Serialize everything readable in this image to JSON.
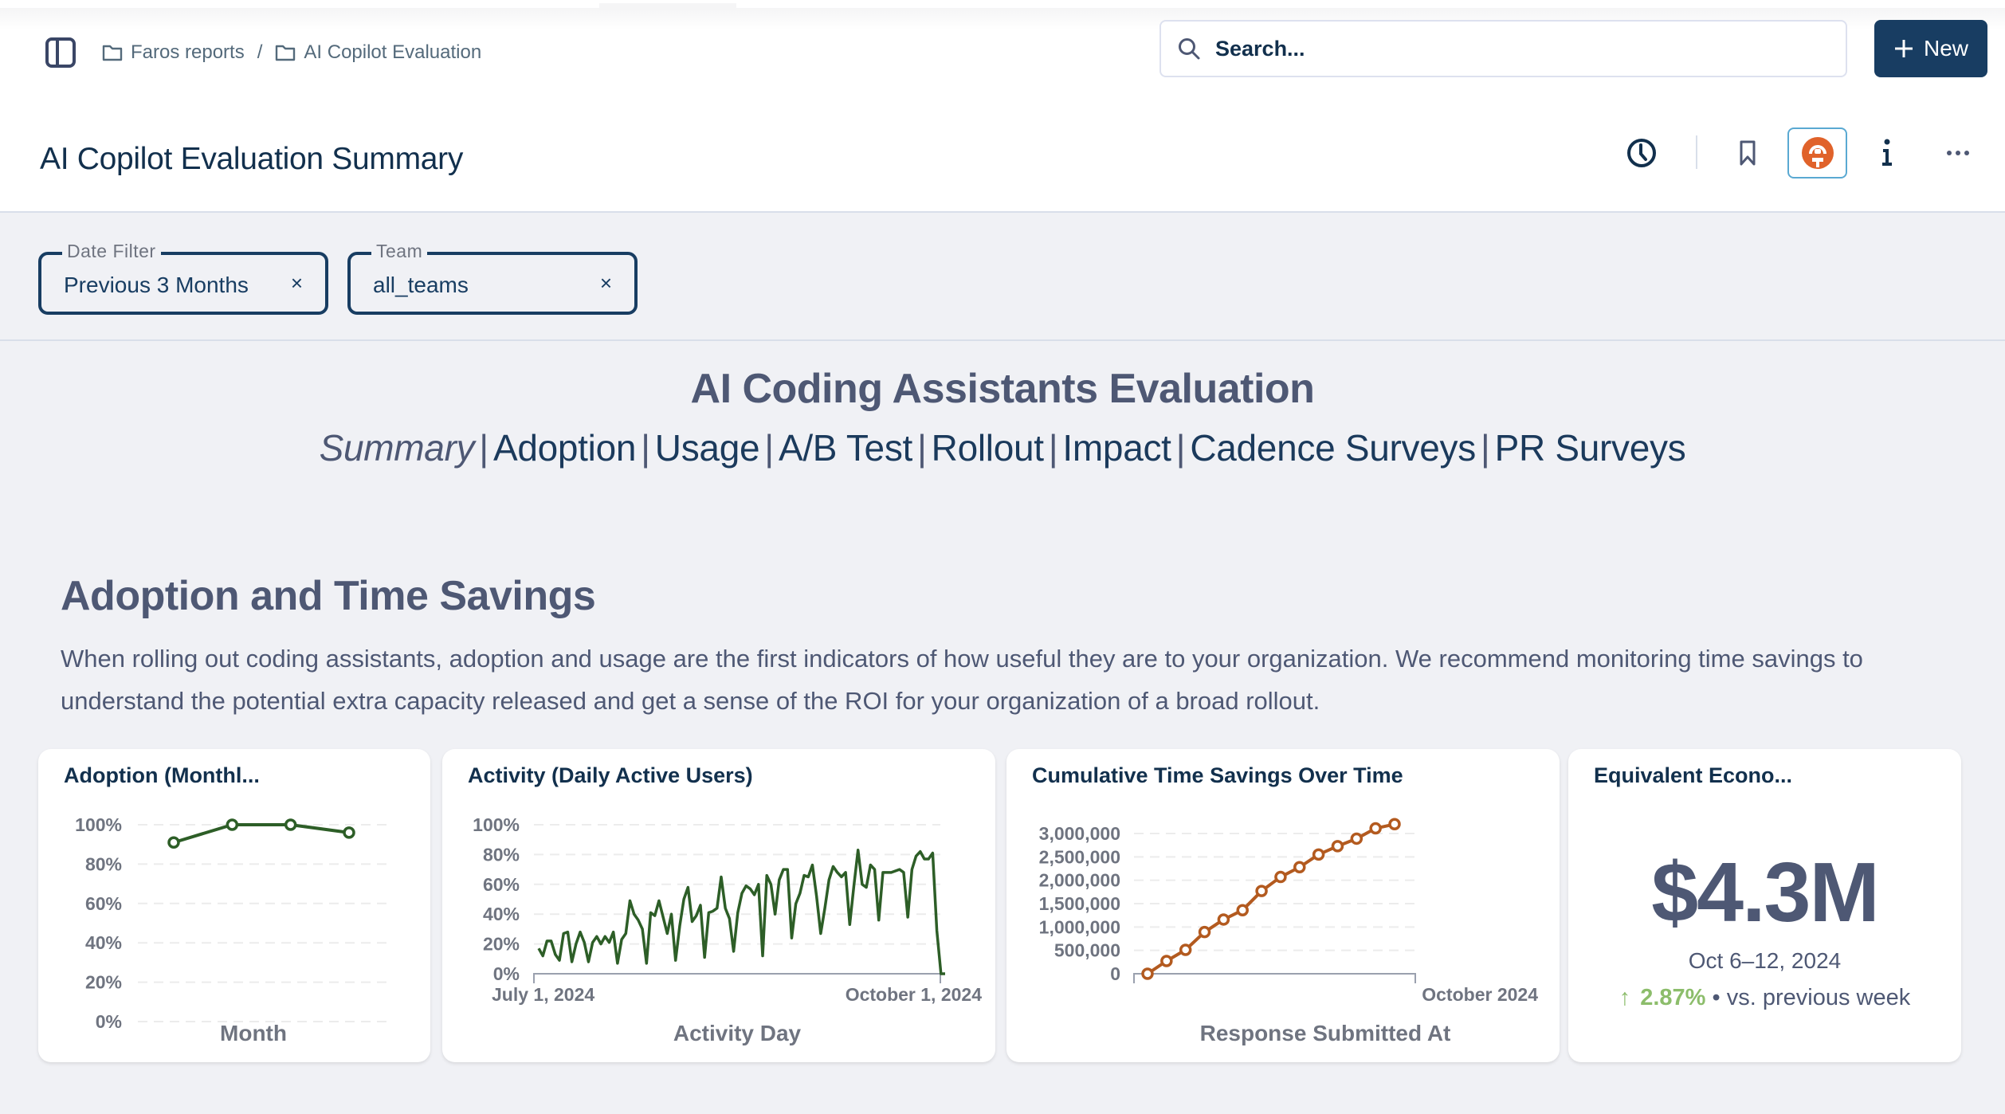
{
  "breadcrumb": [
    {
      "label": "Faros reports",
      "icon": "folder-icon"
    },
    {
      "label": "AI Copilot Evaluation",
      "icon": "folder-icon"
    }
  ],
  "breadcrumb_separator": "/",
  "search": {
    "placeholder": "Search...",
    "value": ""
  },
  "new_button": {
    "label": "New",
    "icon": "plus-icon"
  },
  "page_title": "AI Copilot Evaluation Summary",
  "header_actions": [
    "history-clock-icon",
    "bookmark-icon",
    "ai-assistant-icon",
    "info-icon",
    "more-options-icon"
  ],
  "filters": [
    {
      "label": "Date Filter",
      "value": "Previous 3 Months",
      "clear": "×"
    },
    {
      "label": "Team",
      "value": "all_teams",
      "clear": "×"
    }
  ],
  "dashboard_title": "AI Coding Assistants Evaluation",
  "dashboard_nav": {
    "current": "Summary",
    "links": [
      "Adoption",
      "Usage",
      "A/B Test",
      "Rollout",
      "Impact",
      "Cadence Surveys",
      "PR Surveys"
    ],
    "separator": "|"
  },
  "section": {
    "title": "Adoption and Time Savings",
    "description": "When rolling out coding assistants, adoption and usage are the first indicators of how useful they are to your organization. We recommend monitoring time savings to understand the potential extra capacity released and get a sense of the ROI for your organization of a broad rollout."
  },
  "colors": {
    "primary": "#183d62",
    "adoption_line": "#2d5e27",
    "savings_line": "#b35a1f",
    "positive": "#8cbd6b",
    "ai_badge": "#e0622a"
  },
  "kpi": {
    "title": "Equivalent Econo...",
    "value": "$4.3M",
    "period": "Oct 6–12, 2024",
    "change_direction": "up",
    "change": "2.87%",
    "bullet": "•",
    "comparison": "vs. previous week"
  },
  "chart_data": [
    {
      "type": "line",
      "title": "Adoption (Monthl...",
      "xlabel": "Month",
      "ylabel": "",
      "x_tick_labels": [],
      "y_tick_labels": [
        "100%",
        "80%",
        "60%",
        "40%",
        "20%",
        "0%"
      ],
      "ylim": [
        0,
        100
      ],
      "grid": true,
      "markers": true,
      "series": [
        {
          "name": "Adoption",
          "values": [
            91,
            100,
            100,
            96
          ]
        }
      ]
    },
    {
      "type": "line",
      "title": "Activity (Daily Active Users)",
      "xlabel": "Activity Day",
      "ylabel": "",
      "x_tick_labels": [
        "July 1, 2024",
        "October 1, 2024"
      ],
      "y_tick_labels": [
        "100%",
        "80%",
        "60%",
        "40%",
        "20%",
        "0%"
      ],
      "ylim": [
        0,
        100
      ],
      "grid": true,
      "markers": false,
      "series": [
        {
          "name": "Daily Active Users",
          "values": [
            17,
            12,
            22,
            22,
            13,
            9,
            27,
            28,
            8,
            20,
            28,
            21,
            8,
            21,
            25,
            20,
            25,
            21,
            28,
            7,
            23,
            27,
            49,
            40,
            36,
            30,
            7,
            41,
            39,
            49,
            38,
            27,
            40,
            9,
            32,
            50,
            58,
            35,
            39,
            46,
            11,
            41,
            42,
            44,
            65,
            44,
            37,
            15,
            41,
            54,
            59,
            57,
            53,
            60,
            12,
            66,
            60,
            40,
            63,
            70,
            70,
            24,
            47,
            54,
            66,
            65,
            73,
            52,
            27,
            44,
            63,
            72,
            68,
            65,
            68,
            33,
            59,
            83,
            60,
            58,
            73,
            70,
            36,
            68,
            68,
            68,
            69,
            70,
            68,
            38,
            70,
            79,
            82,
            77,
            77,
            81,
            29,
            0,
            0
          ]
        }
      ]
    },
    {
      "type": "line",
      "title": "Cumulative Time Savings Over Time",
      "xlabel": "Response Submitted At",
      "ylabel": "",
      "x_tick_labels": [
        "October 2024"
      ],
      "y_tick_labels": [
        "3,000,000",
        "2,500,000",
        "2,000,000",
        "1,500,000",
        "1,000,000",
        "500,000",
        "0"
      ],
      "ylim": [
        0,
        3000000
      ],
      "grid": true,
      "markers": true,
      "series": [
        {
          "name": "Cumulative Time Savings",
          "values": [
            0,
            273000,
            511000,
            892000,
            1160000,
            1360000,
            1770000,
            2070000,
            2280000,
            2550000,
            2730000,
            2890000,
            3110000,
            3200000
          ]
        }
      ]
    }
  ]
}
